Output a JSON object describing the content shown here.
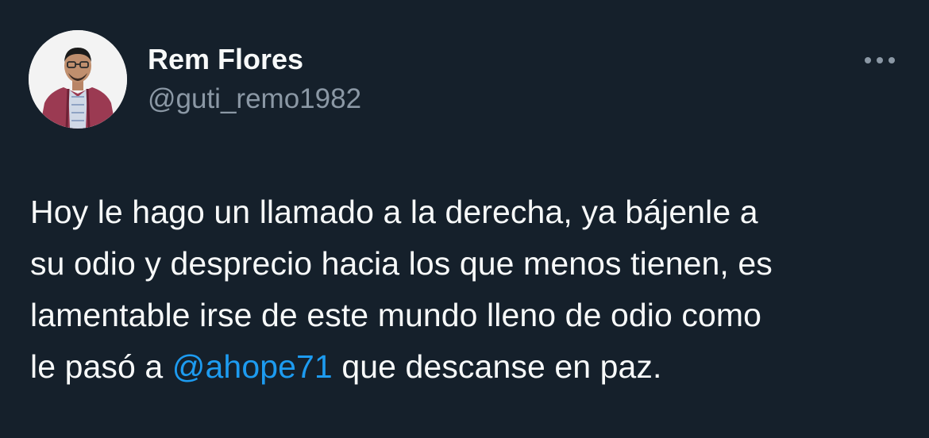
{
  "author": {
    "name": "Rem Flores",
    "handle": "@guti_remo1982",
    "avatar_icon": "profile-photo"
  },
  "more_icon": "more-options-icon",
  "body": {
    "line1": "Hoy le hago un llamado a la derecha, ya bájenle a",
    "line2": "su odio y desprecio hacia los que menos tienen, es",
    "line3": "lamentable irse de este mundo lleno de odio como",
    "line4_before": "le pasó a ",
    "mention": "@ahope71",
    "line4_after": " que descanse en paz."
  },
  "colors": {
    "background": "#15202b",
    "text_primary": "#f7f9f9",
    "text_secondary": "#8b98a5",
    "link": "#1d9bf0"
  }
}
